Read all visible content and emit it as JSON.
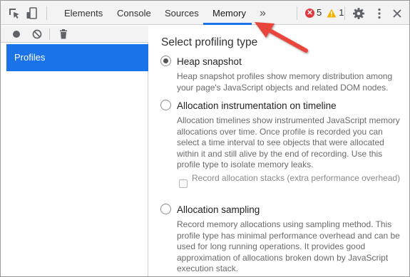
{
  "tabs": [
    {
      "label": "Elements",
      "active": false
    },
    {
      "label": "Console",
      "active": false
    },
    {
      "label": "Sources",
      "active": false
    },
    {
      "label": "Memory",
      "active": true
    }
  ],
  "more_tabs_label": "»",
  "status": {
    "errors": "5",
    "warnings": "1",
    "error_color": "#e0393e",
    "warning_color": "#f2b200"
  },
  "icons": {
    "inspect": "cursor-select-icon",
    "device": "device-toggle-icon",
    "record": "record-icon",
    "clear": "clear-icon",
    "trash": "trash-icon",
    "settings": "gear-icon",
    "menu": "kebab-menu-icon",
    "close": "close-icon"
  },
  "sidebar": {
    "profiles_label": "Profiles"
  },
  "main": {
    "title": "Select profiling type",
    "options": [
      {
        "label": "Heap snapshot",
        "selected": true,
        "description": "Heap snapshot profiles show memory distribution among your page's JavaScript objects and related DOM nodes."
      },
      {
        "label": "Allocation instrumentation on timeline",
        "selected": false,
        "description": "Allocation timelines show instrumented JavaScript memory allocations over time. Once profile is recorded you can select a time interval to see objects that were allocated within it and still alive by the end of recording. Use this profile type to isolate memory leaks.",
        "checkbox_label": "Record allocation stacks (extra performance overhead)",
        "checkbox_checked": false
      },
      {
        "label": "Allocation sampling",
        "selected": false,
        "description": "Record memory allocations using sampling method. This profile type has minimal performance overhead and can be used for long running operations. It provides good approximation of allocations broken down by JavaScript execution stack."
      }
    ]
  },
  "colors": {
    "accent": "#1a73e8",
    "annotation_arrow": "#e8453c"
  }
}
